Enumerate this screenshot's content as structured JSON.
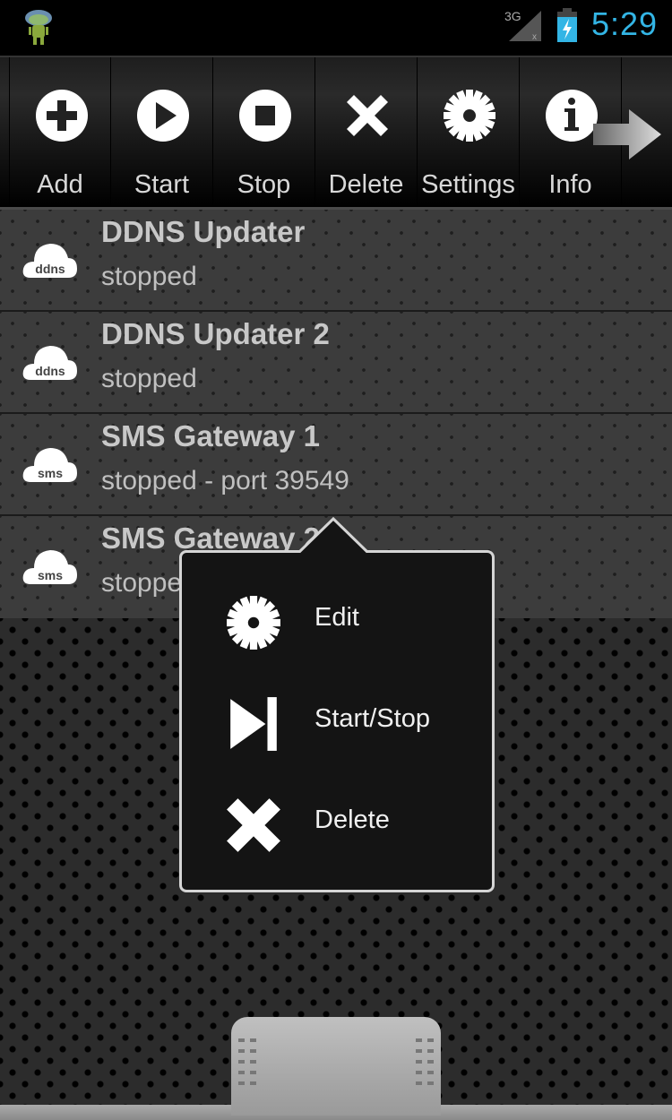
{
  "status_bar": {
    "app_icon": "android-cloud-icon",
    "network_label": "3G",
    "signal_icon": "signal-no-data-icon",
    "battery_icon": "battery-charging-icon",
    "time": "5:29",
    "time_color": "#33b5e5"
  },
  "toolbar": {
    "buttons": [
      {
        "label": "Add",
        "icon": "plus-circle-icon"
      },
      {
        "label": "Start",
        "icon": "play-circle-icon"
      },
      {
        "label": "Stop",
        "icon": "stop-circle-icon"
      },
      {
        "label": "Delete",
        "icon": "x-icon"
      },
      {
        "label": "Settings",
        "icon": "gear-icon"
      },
      {
        "label": "Info",
        "icon": "info-circle-icon"
      }
    ],
    "more_icon": "arrow-right-icon"
  },
  "services": [
    {
      "title": "DDNS Updater",
      "status": "stopped",
      "icon_text": "ddns"
    },
    {
      "title": "DDNS Updater 2",
      "status": "stopped",
      "icon_text": "ddns"
    },
    {
      "title": "SMS Gateway 1",
      "status": "stopped - port 39549",
      "icon_text": "sms"
    },
    {
      "title": "SMS Gateway 2",
      "status": "stopped",
      "icon_text": "sms"
    }
  ],
  "context_menu": {
    "items": [
      {
        "label": "Edit",
        "icon": "gear-icon"
      },
      {
        "label": "Start/Stop",
        "icon": "play-pause-icon"
      },
      {
        "label": "Delete",
        "icon": "x-icon"
      }
    ]
  },
  "drawer": {
    "handle_icon": "drawer-handle-icon"
  }
}
